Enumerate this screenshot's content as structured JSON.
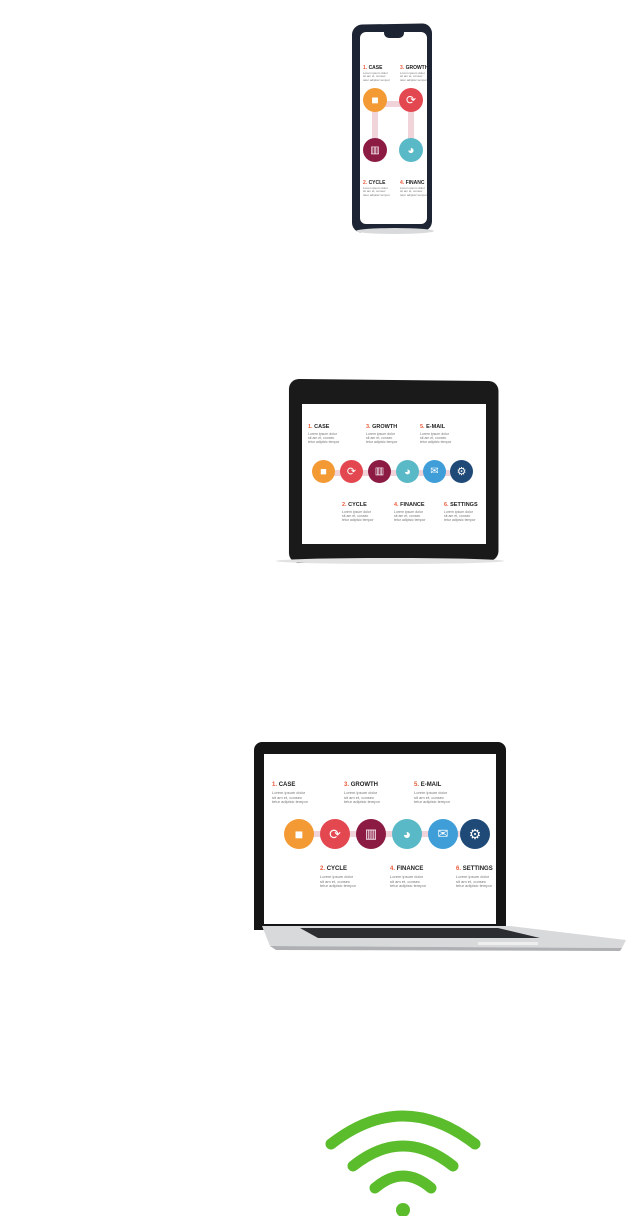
{
  "slide": {
    "items": [
      {
        "num": "1.",
        "title": "CASE",
        "desc": "Lorem ipsum dolor\nsit am et, consec\ntetur adipisic tempor",
        "icon": "briefcase-icon",
        "color": "#f39a34"
      },
      {
        "num": "2.",
        "title": "CYCLE",
        "desc": "Lorem ipsum dolor\nsit am et, consec\ntetur adipisic tempor",
        "icon": "cycle-icon",
        "color": "#e3474f"
      },
      {
        "num": "3.",
        "title": "GROWTH",
        "desc": "Lorem ipsum dolor\nsit am et, consec\ntetur adipisic tempor",
        "icon": "bar-chart-icon",
        "color": "#8c1b43"
      },
      {
        "num": "4.",
        "title": "FINANCE",
        "desc": "Lorem ipsum dolor\nsit am et, consec\ntetur adipisic tempor",
        "icon": "pie-chart-icon",
        "color": "#5ab9c6"
      },
      {
        "num": "5.",
        "title": "E-MAIL",
        "desc": "Lorem ipsum dolor\nsit am et, consec\ntetur adipisic tempor",
        "icon": "envelope-icon",
        "color": "#3f9ed8"
      },
      {
        "num": "6.",
        "title": "SETTINGS",
        "desc": "Lorem ipsum dolor\nsit am et, consec\ntetur adipisic tempor",
        "icon": "gear-icon",
        "color": "#1f4a77"
      }
    ],
    "phone_finance_title": "FINANC"
  },
  "colors": {
    "wifi_green": "#5bbd2c"
  }
}
